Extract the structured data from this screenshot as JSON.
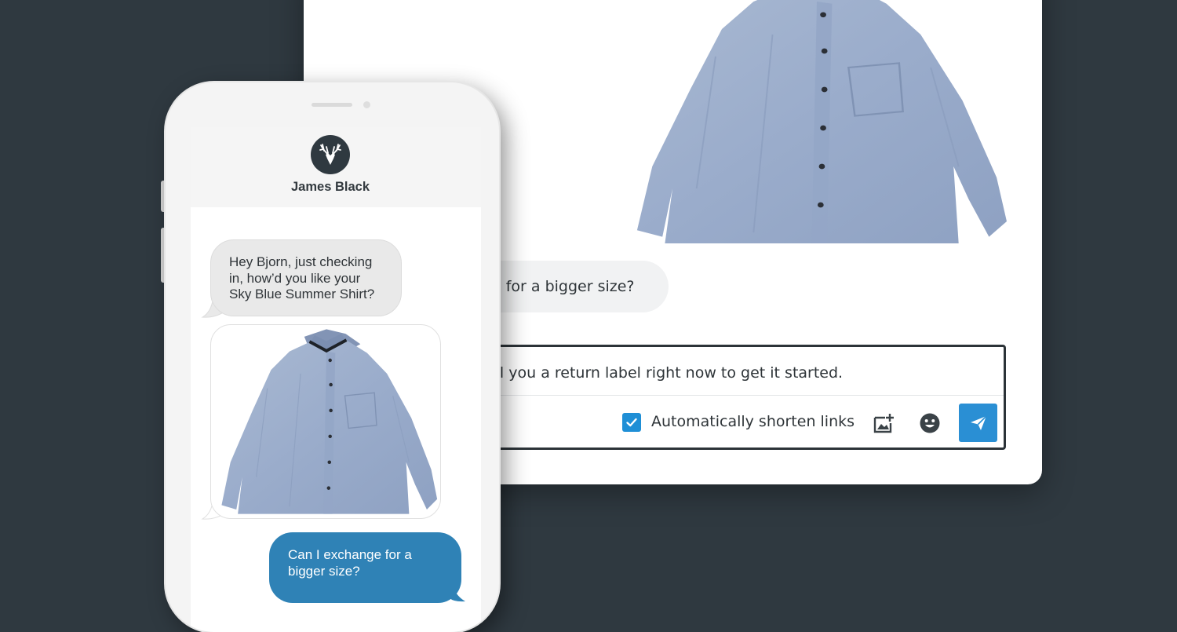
{
  "desktop": {
    "incoming_message": "e for a bigger size?",
    "composer_text": "ail you a return label right now to get it started.",
    "shorten_links_label": "Automatically shorten links",
    "shorten_links_checked": true,
    "icons": {
      "add_image": "add-image-icon",
      "emoji": "emoji-icon",
      "send": "send-icon",
      "checkbox": "checkmark-icon"
    },
    "colors": {
      "send_button": "#2a8fd4",
      "checkbox": "#1f8fd6"
    }
  },
  "phone": {
    "contact_name": "James Black",
    "avatar_icon": "deer-antlers-icon",
    "messages": [
      {
        "direction": "incoming",
        "lines": [
          "Hey Bjorn, just checking",
          "in, how’d you like your",
          "Sky Blue Summer Shirt?"
        ]
      },
      {
        "direction": "incoming",
        "type": "image",
        "image": "shirt-photo"
      },
      {
        "direction": "outgoing",
        "lines": [
          "Can I exchange for a",
          "bigger size?"
        ]
      }
    ],
    "colors": {
      "outgoing_bubble": "#2f82b6",
      "incoming_bubble": "#e9e9e9"
    }
  },
  "colors": {
    "background": "#2f3940"
  }
}
